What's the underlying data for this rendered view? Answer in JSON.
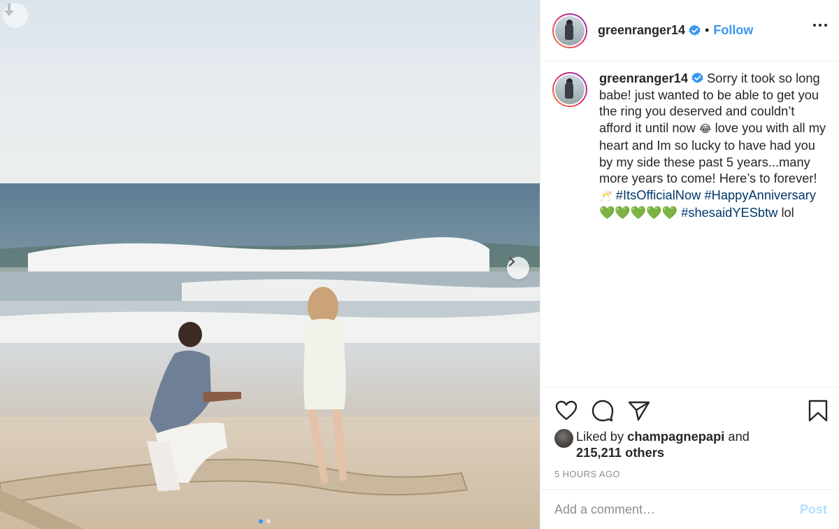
{
  "post": {
    "username": "greenranger14",
    "separator": "•",
    "follow_label": "Follow",
    "more_icon": "more-horizontal-icon",
    "verified_color": "#3897f0",
    "accent_color": "#3897f0"
  },
  "caption": {
    "username": "greenranger14",
    "part1": " Sorry it took so long babe! just wanted to be able to get you the ring you deserved and couldn’t afford it until now ",
    "emoji_laugh": "😂",
    "part2": " love you with all my heart and Im so lucky to have had you by my side these past 5 years...many more years to come! Here’s to forever!",
    "emoji_cheers": "🥂",
    "hashtag1": "#ItsOfficialNow",
    "hashtag2": "#HappyAnniversary",
    "hearts": "💚💚💚💚💚",
    "hashtag3": "#shesaidYESbtw",
    "tail": " lol"
  },
  "actions": {
    "like_icon": "heart-icon",
    "comment_icon": "comment-icon",
    "share_icon": "share-icon",
    "save_icon": "bookmark-icon"
  },
  "likes": {
    "prefix": "Liked by ",
    "liker": "champagnepapi",
    "middle": " and",
    "count": "215,211 others"
  },
  "timestamp": "5 HOURS AGO",
  "comment": {
    "placeholder": "Add a comment…",
    "post_label": "Post"
  },
  "carousel": {
    "total": 2,
    "current": 1
  }
}
